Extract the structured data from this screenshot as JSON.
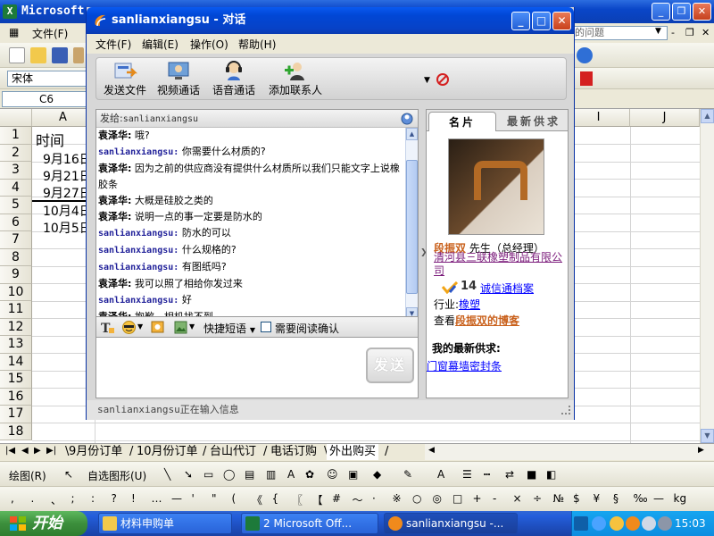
{
  "excel": {
    "title": "Microsoft",
    "menu": {
      "file": "文件(F)"
    },
    "help_placeholder": "的问题",
    "font_name": "宋体",
    "name_box": "C6",
    "columns": [
      "A",
      "I",
      "J"
    ],
    "rows": [
      "1",
      "2",
      "3",
      "4",
      "5",
      "6",
      "7",
      "8",
      "9",
      "10",
      "11",
      "12",
      "13",
      "14",
      "15",
      "16",
      "17",
      "18"
    ],
    "cells": {
      "a1": "时间",
      "a2": "9月16日",
      "a3": "9月21日",
      "a4": "9月27日",
      "a5": "10月4日",
      "a6": "10月5日"
    },
    "sheet_tabs": [
      "9月份订单",
      "10月份订单",
      "台山代订",
      "电话订购",
      "外出购买"
    ],
    "drawing_toolbar": {
      "draw": "绘图(R)",
      "autoshape": "自选图形(U)"
    },
    "symbols": [
      ",",
      ".",
      "、",
      ";",
      ":",
      "?",
      "!",
      "…",
      "—",
      "'",
      "\"",
      "(",
      "《",
      "{",
      "〖",
      "【",
      "#",
      "～",
      "·",
      "※",
      "○",
      "◎",
      "□",
      "+",
      "-",
      "×",
      "÷",
      "№",
      "$",
      "¥",
      "§",
      "‰",
      "—",
      "kg"
    ]
  },
  "taskbar": {
    "start": "开始",
    "items": [
      "材料申购单",
      "2 Microsoft Off...",
      "sanlianxiangsu -..."
    ],
    "clock": "15:03"
  },
  "chat": {
    "title": "sanlianxiangsu - 对话",
    "menu": [
      "文件(F)",
      "编辑(E)",
      "操作(O)",
      "帮助(H)"
    ],
    "tools": [
      "发送文件",
      "视频通话",
      "语音通话",
      "添加联系人"
    ],
    "to_label": "发给:",
    "to_value": "sanlianxiangsu",
    "messages": [
      {
        "sender": "袁泽华",
        "me": false,
        "text": "哦?"
      },
      {
        "sender": "sanlianxiangsu",
        "me": true,
        "text": "你需要什么材质的?"
      },
      {
        "sender": "袁泽华",
        "me": false,
        "text": "因为之前的供应商没有提供什么材质所以我们只能文字上说橡胶条"
      },
      {
        "sender": "袁泽华",
        "me": false,
        "text": "大概是硅胶之类的"
      },
      {
        "sender": "袁泽华",
        "me": false,
        "text": "说明一点的事一定要是防水的"
      },
      {
        "sender": "sanlianxiangsu",
        "me": true,
        "text": "防水的可以"
      },
      {
        "sender": "sanlianxiangsu",
        "me": true,
        "text": "什么规格的?"
      },
      {
        "sender": "sanlianxiangsu",
        "me": true,
        "text": "有图纸吗?"
      },
      {
        "sender": "袁泽华",
        "me": false,
        "text": "我可以照了相给你发过来"
      },
      {
        "sender": "sanlianxiangsu",
        "me": true,
        "text": "好"
      },
      {
        "sender": "袁泽华",
        "me": false,
        "text": "抱歉，相机找不到"
      }
    ],
    "separator": ":",
    "quick_reply": "快捷短语",
    "read_confirm": "需要阅读确认",
    "send": "发送",
    "status": "sanlianxiangsu正在输入信息",
    "card": {
      "tab_card": "名片",
      "tab_supply": "最新供求",
      "name": "段振双",
      "role": "先生（总经理）",
      "company": "清河县三联橡塑制品有限公司",
      "credit_years": "14",
      "credit_label": "诚信通档案",
      "industry_label": "行业:",
      "industry": "橡塑",
      "blog_prefix": "查看",
      "blog_link": "段振双的博客",
      "supply_title": "我的最新供求:",
      "supply_item": "门窗幕墙密封条"
    }
  },
  "colors": {
    "xp_blue": "#0a46c8",
    "msg_me": "#22229a",
    "card_orange": "#c9611c",
    "link_blue": "#0000ff"
  }
}
